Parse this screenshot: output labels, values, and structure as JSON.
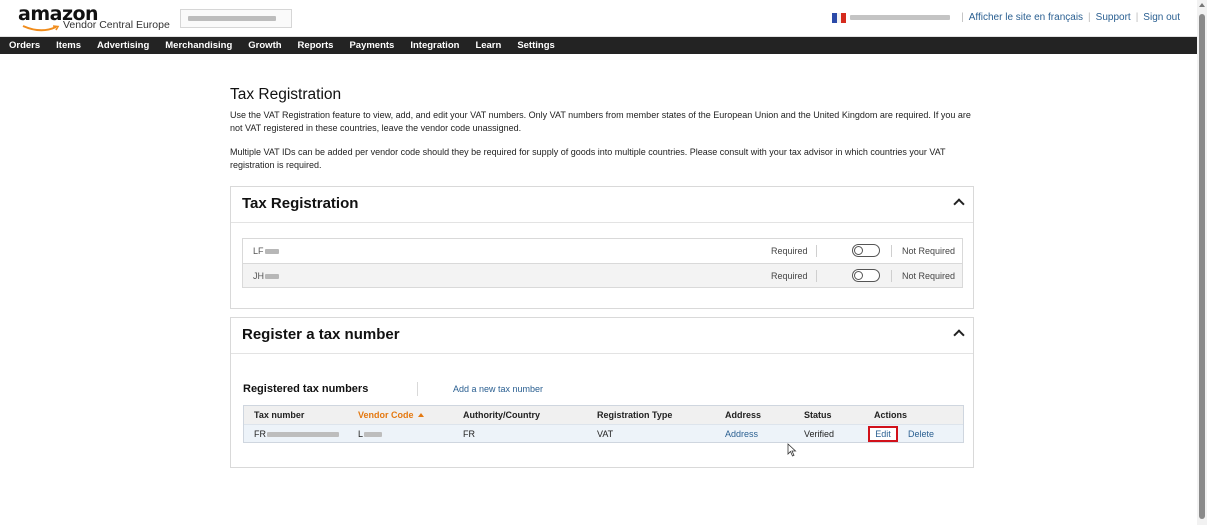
{
  "header": {
    "logo_word": "amazon",
    "logo_subtitle": "Vendor Central Europe",
    "links": [
      "Afficher le site en français",
      "Support",
      "Sign out"
    ]
  },
  "nav": {
    "items": [
      "Orders",
      "Items",
      "Advertising",
      "Merchandising",
      "Growth",
      "Reports",
      "Payments",
      "Integration",
      "Learn",
      "Settings"
    ]
  },
  "page": {
    "title": "Tax Registration",
    "intro_1": "Use the VAT Registration feature to view, add, and edit your VAT numbers. Only VAT numbers from member states of the European Union and the United Kingdom are required. If you are not VAT registered in these countries, leave the vendor code unassigned.",
    "intro_2": "Multiple VAT IDs can be added per vendor code should they be required for supply of goods into multiple countries. Please consult with your tax advisor in which countries your VAT registration is required."
  },
  "tax_registration_panel": {
    "title": "Tax Registration",
    "vendors": [
      {
        "code_prefix": "LF",
        "required_label": "Required",
        "not_required_label": "Not Required"
      },
      {
        "code_prefix": "JH",
        "required_label": "Required",
        "not_required_label": "Not Required"
      }
    ]
  },
  "register_panel": {
    "title": "Register a tax number",
    "section_heading": "Registered tax numbers",
    "add_link": "Add a new tax number",
    "columns": [
      "Tax number",
      "Vendor Code",
      "Authority/Country",
      "Registration Type",
      "Address",
      "Status",
      "Actions"
    ],
    "rows": [
      {
        "tax_number_prefix": "FR",
        "vendor_code_prefix": "L",
        "authority": "FR",
        "registration_type": "VAT",
        "address": "Address",
        "status": "Verified",
        "edit": "Edit",
        "delete": "Delete"
      }
    ]
  },
  "colors": {
    "nav_bg": "#232323",
    "link": "#2a5f91",
    "sort_accent": "#e47911",
    "highlight_border": "#d1111a",
    "row_bg": "#edf3f9"
  }
}
